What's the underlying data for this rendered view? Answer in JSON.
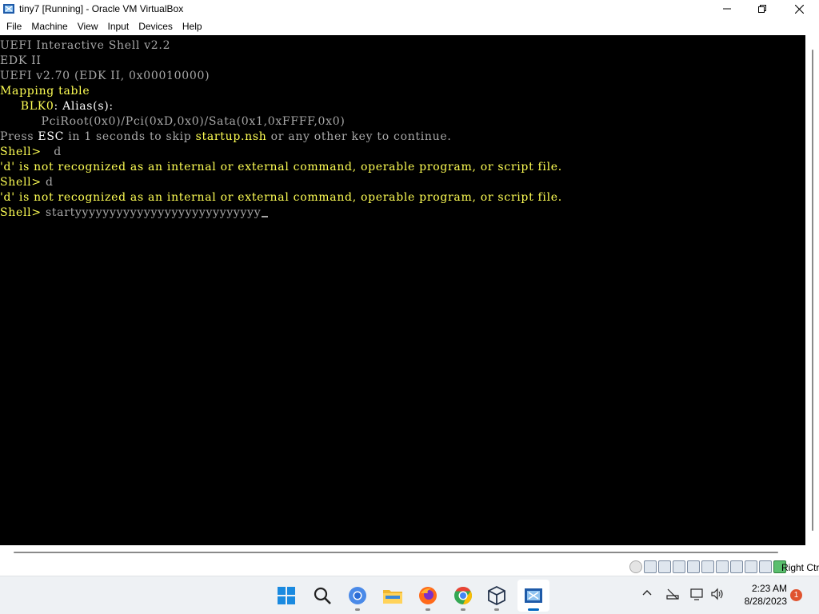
{
  "window": {
    "title": "tiny7 [Running] - Oracle VM VirtualBox",
    "controls": {
      "minimize": "minimize",
      "maximize": "maximize",
      "close": "close"
    }
  },
  "menubar": [
    "File",
    "Machine",
    "View",
    "Input",
    "Devices",
    "Help"
  ],
  "console": {
    "lines": [
      {
        "parts": [
          {
            "text": "UEFI Interactive Shell v2.2",
            "color": "gray"
          }
        ]
      },
      {
        "parts": [
          {
            "text": "EDK II",
            "color": "gray"
          }
        ]
      },
      {
        "parts": [
          {
            "text": "UEFI v2.70 (EDK II, 0x00010000)",
            "color": "gray"
          }
        ]
      },
      {
        "parts": [
          {
            "text": "Mapping table",
            "color": "yellow"
          }
        ]
      },
      {
        "parts": [
          {
            "text": "     BLK0",
            "color": "yellow"
          },
          {
            "text": ": Alias(s):",
            "color": "white"
          }
        ]
      },
      {
        "parts": [
          {
            "text": "          PciRoot(0x0)/Pci(0xD,0x0)/Sata(0x1,0xFFFF,0x0)",
            "color": "gray"
          }
        ]
      },
      {
        "parts": [
          {
            "text": "Press ",
            "color": "gray"
          },
          {
            "text": "ESC",
            "color": "white"
          },
          {
            "text": " in 1 seconds to skip ",
            "color": "gray"
          },
          {
            "text": "startup.nsh",
            "color": "yellow"
          },
          {
            "text": " or any other key to continue.",
            "color": "gray"
          }
        ]
      },
      {
        "parts": [
          {
            "text": "Shell> ",
            "color": "yellow"
          },
          {
            "text": "  d",
            "color": "gray"
          }
        ]
      },
      {
        "parts": [
          {
            "text": "'d' is not recognized as an internal or external command, operable program, or script file.",
            "color": "yellow"
          }
        ]
      },
      {
        "parts": [
          {
            "text": "Shell> ",
            "color": "yellow"
          },
          {
            "text": "d",
            "color": "gray"
          }
        ]
      },
      {
        "parts": [
          {
            "text": "'d' is not recognized as an internal or external command, operable program, or script file.",
            "color": "yellow"
          }
        ]
      },
      {
        "parts": [
          {
            "text": "Shell> ",
            "color": "yellow"
          },
          {
            "text": "startyyyyyyyyyyyyyyyyyyyyyyyyyyy",
            "color": "gray"
          }
        ],
        "cursor": true
      }
    ]
  },
  "statusbar": {
    "icons": [
      "optical-drive-icon",
      "harddisk-icon",
      "audio-icon",
      "network-icon",
      "usb-icon",
      "shared-folder-icon",
      "display-icon",
      "recording-icon",
      "mouse-integration-icon",
      "cpu-icon",
      "green-arrow-icon"
    ],
    "host_key": "Right Ctrl"
  },
  "taskbar": {
    "apps": [
      "windows-start-icon",
      "search-icon",
      "chromium-icon",
      "file-explorer-icon",
      "firefox-icon",
      "chrome-icon",
      "virtualbox-icon",
      "vm-window-icon"
    ],
    "time": "2:23 AM",
    "date": "8/28/2023",
    "notification_count": "1"
  },
  "colors": {
    "gray": "#a8a8a8",
    "yellow": "#ffff54",
    "white": "#fcfcfc",
    "accent": "#0067c0"
  }
}
